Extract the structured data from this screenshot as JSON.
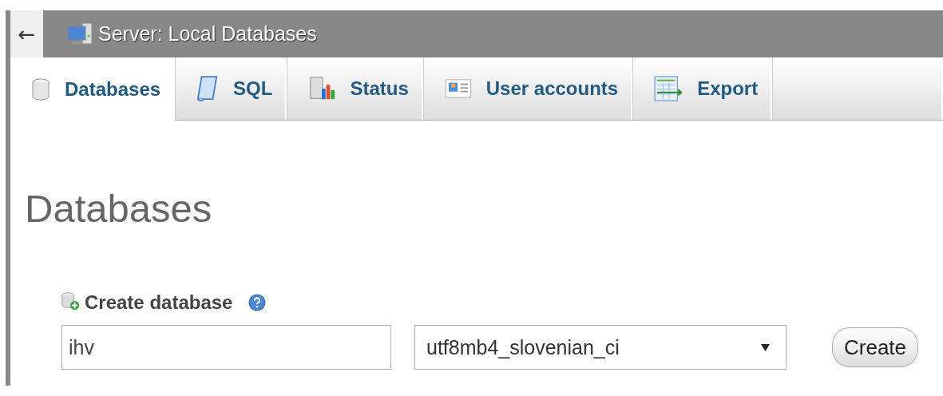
{
  "breadcrumb": {
    "back": "←",
    "title": "Server: Local Databases"
  },
  "tabs": [
    {
      "label": "Databases",
      "kind": "databases",
      "selected": true
    },
    {
      "label": "SQL",
      "kind": "sql",
      "selected": false
    },
    {
      "label": "Status",
      "kind": "status",
      "selected": false
    },
    {
      "label": "User accounts",
      "kind": "users",
      "selected": false
    },
    {
      "label": "Export",
      "kind": "export",
      "selected": false
    }
  ],
  "heading": "Databases",
  "create_database": {
    "title": "Create database",
    "name": {
      "value": "ihv"
    },
    "collation": {
      "value": "utf8mb4_slovenian_ci"
    },
    "button": "Create"
  }
}
